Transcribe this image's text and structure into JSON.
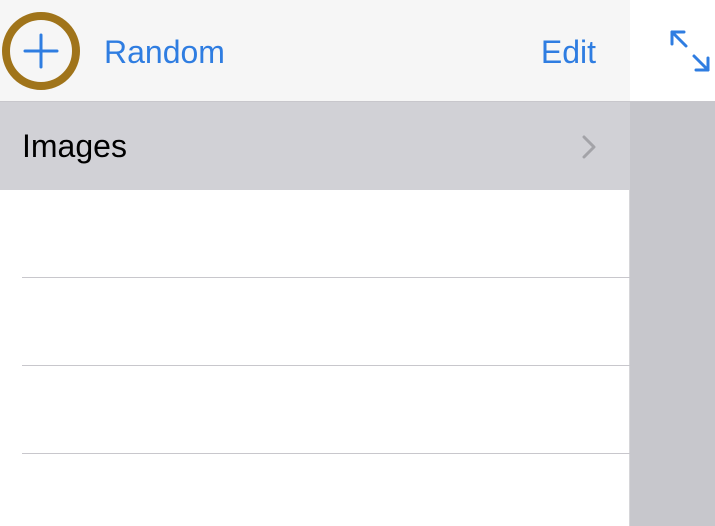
{
  "navbar": {
    "add_icon": "plus-icon",
    "random_label": "Random",
    "edit_label": "Edit",
    "accent_color": "#2f7de1",
    "highlight_ring_color": "#a0741a"
  },
  "list": {
    "items": [
      {
        "label": "Images",
        "icon": "chevron-right-icon",
        "selected": true
      }
    ],
    "empty_rows": 3
  },
  "detail": {
    "expand_icon": "expand-arrows-icon"
  }
}
